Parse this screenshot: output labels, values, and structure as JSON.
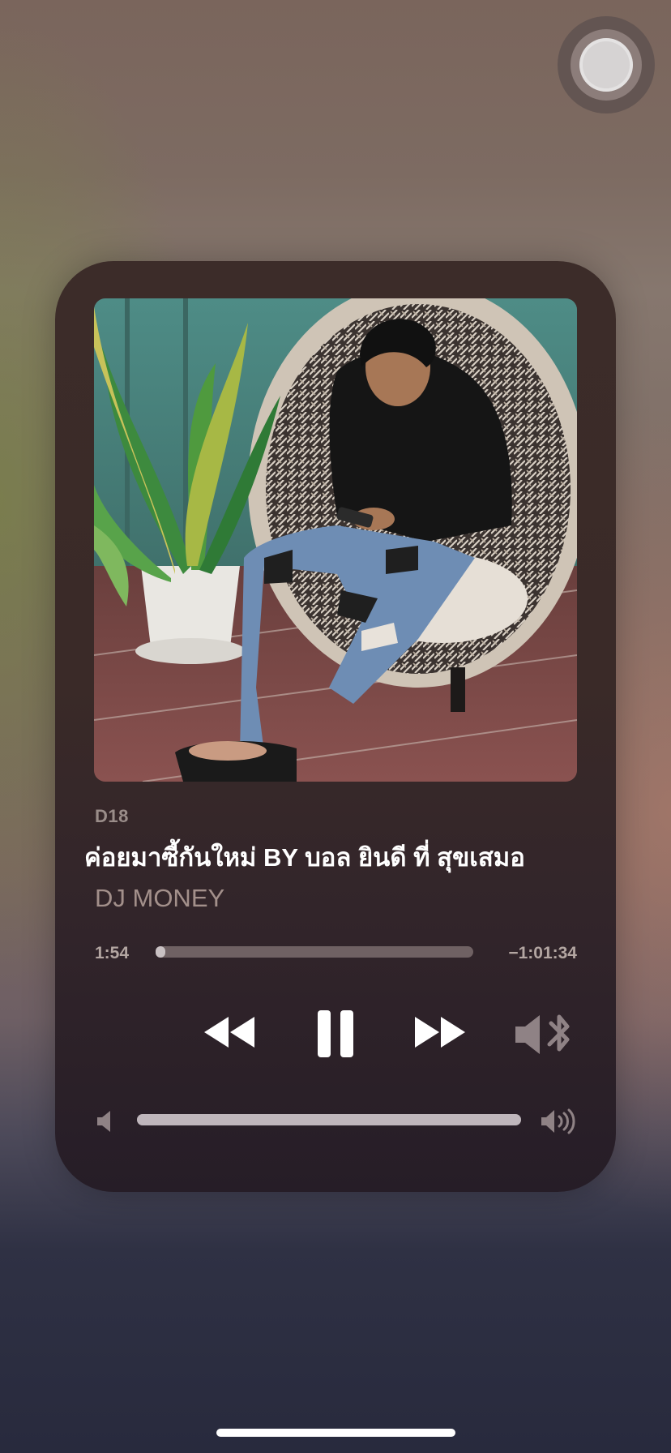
{
  "player": {
    "source": "D18",
    "title": "ค่อยมาซี้กันใหม่  BY บอล ยินดี ที่ สุขเสมอ",
    "artist": "DJ MONEY",
    "elapsed": "1:54",
    "remaining": "−1:01:34",
    "progress_fraction": 0.03,
    "volume_fraction": 1.0
  },
  "controls": {
    "rewind_icon": "rewind-icon",
    "pause_icon": "pause-icon",
    "forward_icon": "fast-forward-icon",
    "route_icon": "speaker-bluetooth-icon",
    "volume_low_icon": "volume-low-icon",
    "volume_high_icon": "volume-high-icon"
  },
  "colors": {
    "card": "#3a2a28",
    "primary_text": "#ffffff",
    "secondary_text": "#a3908b"
  }
}
